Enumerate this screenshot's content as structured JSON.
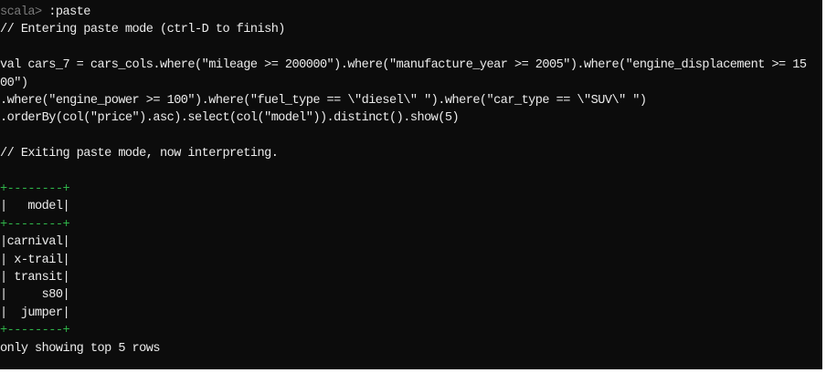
{
  "terminal": {
    "prompt": "scala>",
    "command": " :paste",
    "paste_enter": "// Entering paste mode (ctrl-D to finish)",
    "code_lines": [
      "val cars_7 = cars_cols.where(\"mileage >= 200000\").where(\"manufacture_year >= 2005\").where(\"engine_displacement >= 15",
      "00\")",
      ".where(\"engine_power >= 100\").where(\"fuel_type == \\\"diesel\\\" \").where(\"car_type == \\\"SUV\\\" \")",
      ".orderBy(col(\"price\").asc).select(col(\"model\")).distinct().show(5)"
    ],
    "paste_exit": "// Exiting paste mode, now interpreting.",
    "table": {
      "border": "+--------+",
      "header": "|   model|",
      "rows": [
        "|carnival|",
        "| x-trail|",
        "| transit|",
        "|     s80|",
        "|  jumper|"
      ]
    },
    "footer": "only showing top 5 rows"
  }
}
